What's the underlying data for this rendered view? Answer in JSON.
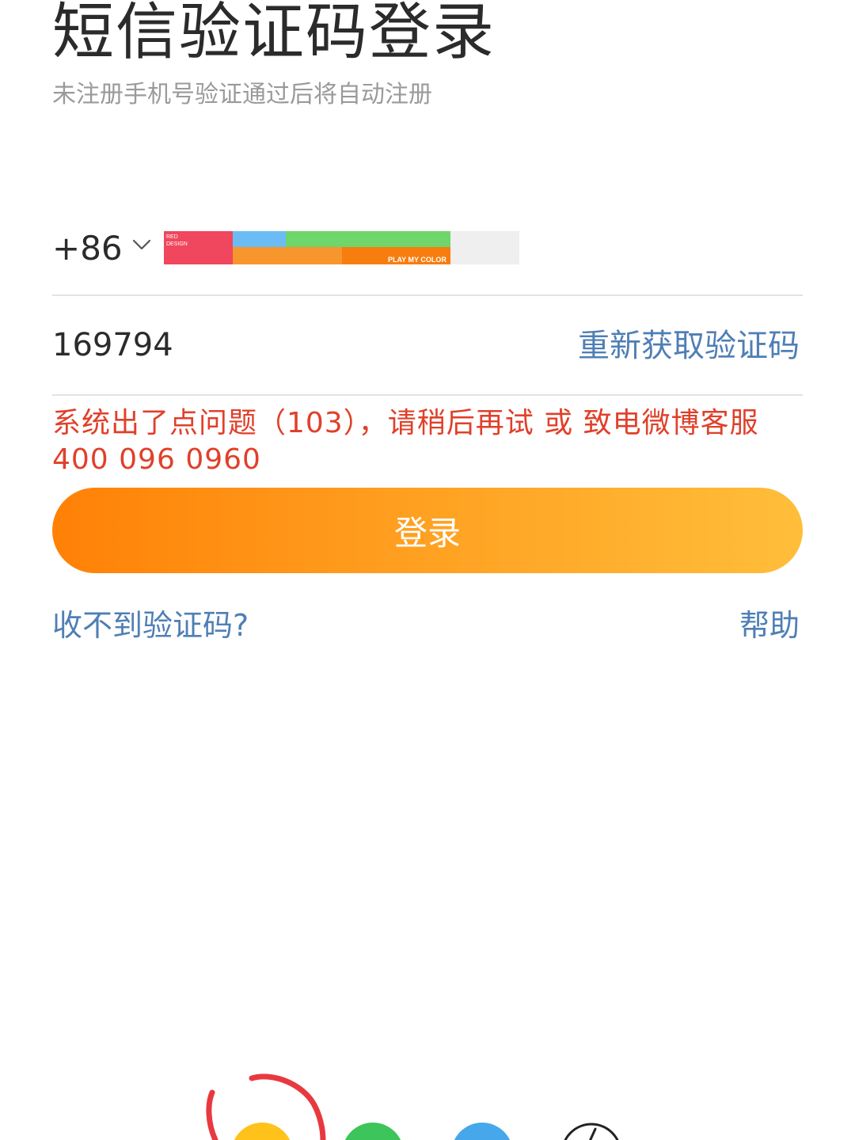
{
  "header": {
    "title": "短信验证码登录",
    "subtitle": "未注册手机号验证通过后将自动注册"
  },
  "phone": {
    "country_code": "+86",
    "redacted_label_top": "RED",
    "redacted_label_bottom": "DESIGN",
    "redacted_caption": "PLAY MY COLOR"
  },
  "verification": {
    "code_value": "169794",
    "resend_label": "重新获取验证码"
  },
  "error": {
    "message": "系统出了点问题（103），请稍后再试 或 致电微博客服 400 096 0960"
  },
  "actions": {
    "login_label": "登录",
    "no_code_label": "收不到验证码?",
    "help_label": "帮助"
  },
  "colors": {
    "accent_link": "#4f7fb5",
    "error": "#e0402a",
    "login_gradient_start": "#ff8106",
    "login_gradient_end": "#ffbe3a",
    "annotation_circle": "#e8393f"
  },
  "third_party_icons": [
    "sso-yellow-icon",
    "sso-green-icon",
    "sso-blue-icon",
    "sso-outline-icon"
  ]
}
